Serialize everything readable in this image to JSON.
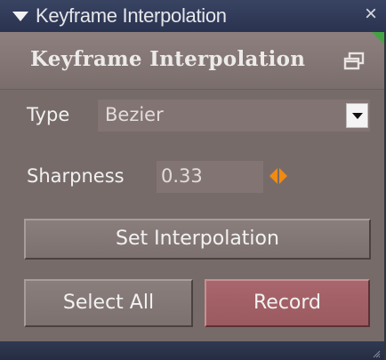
{
  "window": {
    "title": "Keyframe Interpolation",
    "close_glyph": "×",
    "icons": [
      "collapse-arrow-icon",
      "close-icon",
      "restore-window-icon",
      "resize-grip-icon"
    ]
  },
  "panel": {
    "title": "Keyframe Interpolation"
  },
  "type": {
    "label": "Type",
    "value": "Bezier"
  },
  "sharpness": {
    "label": "Sharpness",
    "value": "0.33"
  },
  "buttons": {
    "set_interpolation": "Set Interpolation",
    "select_all": "Select All",
    "record": "Record"
  },
  "colors": {
    "titlebar": "#2f3a58",
    "panel_bg": "#766b69",
    "field_bg": "#827473",
    "record_accent": "#a9666c",
    "spinner_accent": "#f08a12"
  }
}
